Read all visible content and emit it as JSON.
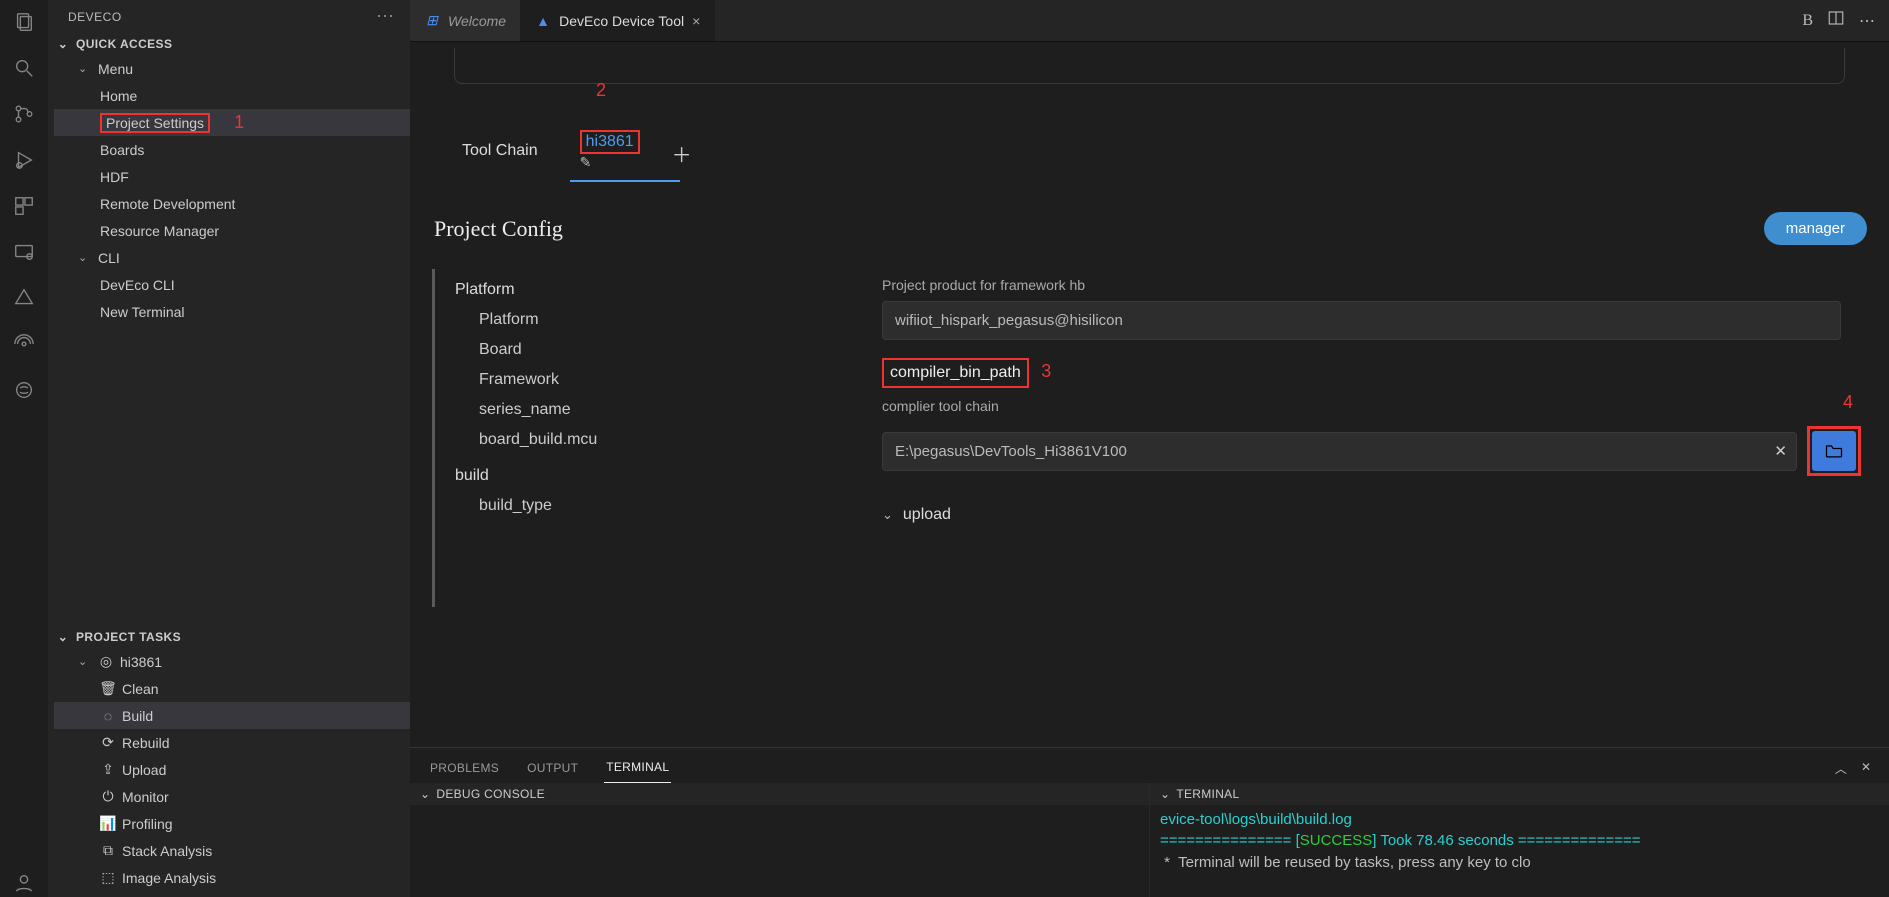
{
  "sidebar": {
    "title": "DEVECO",
    "quick_access_label": "QUICK ACCESS",
    "menu_label": "Menu",
    "menu_items": [
      "Home",
      "Project Settings",
      "Boards",
      "HDF",
      "Remote Development",
      "Resource Manager"
    ],
    "cli_label": "CLI",
    "cli_items": [
      "DevEco CLI",
      "New Terminal"
    ],
    "project_tasks_label": "PROJECT TASKS",
    "target_name": "hi3861",
    "tasks": [
      "Clean",
      "Build",
      "Rebuild",
      "Upload",
      "Monitor",
      "Profiling",
      "Stack Analysis",
      "Image Analysis"
    ]
  },
  "annotations": {
    "a1": "1",
    "a2": "2",
    "a3": "3",
    "a4": "4"
  },
  "tabs": {
    "welcome": "Welcome",
    "deveco": "DevEco Device Tool"
  },
  "titlebar": {
    "b": "B"
  },
  "inner_tabs": {
    "toolchain": "Tool Chain",
    "target": "hi3861"
  },
  "project_config": {
    "heading": "Project Config",
    "manager_btn": "manager",
    "nav": {
      "platform": "Platform",
      "platform_sub": "Platform",
      "board": "Board",
      "framework": "Framework",
      "series_name": "series_name",
      "board_build_mcu": "board_build.mcu",
      "build": "build",
      "build_type": "build_type"
    },
    "form": {
      "product_label": "Project product for framework hb",
      "product_value": "wifiiot_hispark_pegasus@hisilicon",
      "compiler_label": "compiler_bin_path",
      "compiler_desc": "complier tool chain",
      "compiler_value": "E:\\pegasus\\DevTools_Hi3861V100",
      "upload_label": "upload"
    }
  },
  "panel": {
    "problems": "PROBLEMS",
    "output": "OUTPUT",
    "terminal": "TERMINAL",
    "debug_console": "DEBUG CONSOLE",
    "terminal_title": "TERMINAL",
    "term_line1_a": "evice-tool\\logs\\build\\build.log",
    "term_line2_a": "=============== [",
    "term_line2_b": "SUCCESS",
    "term_line2_c": "] Took 78.46 seconds ==============",
    "term_line3": " *  Terminal will be reused by tasks, press any key to clo"
  }
}
